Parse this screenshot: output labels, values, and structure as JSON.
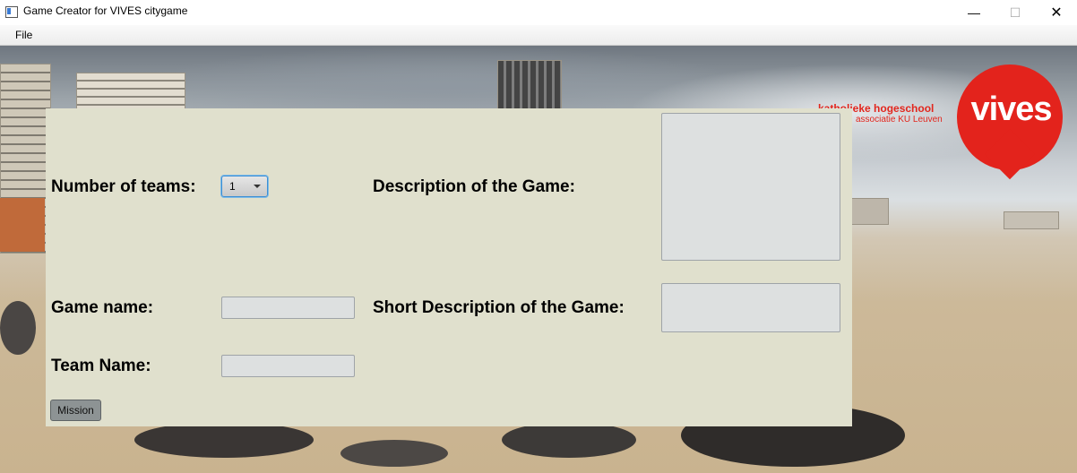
{
  "window": {
    "title": "Game Creator for VIVES citygame",
    "minimize_glyph": "—",
    "maximize_glyph": "☐",
    "close_glyph": "✕"
  },
  "menu": {
    "items": [
      "File"
    ]
  },
  "logo": {
    "line1": "katholieke hogeschool",
    "line2": "associatie KU Leuven",
    "word": "vives",
    "color": "#e3231c"
  },
  "form": {
    "teams_label": "Number of teams:",
    "teams_value": "1",
    "description_label": "Description of the Game:",
    "description_value": "",
    "game_name_label": "Game name:",
    "game_name_value": "",
    "short_description_label": "Short Description of the Game:",
    "short_description_value": "",
    "team_name_label": "Team Name:",
    "team_name_value": "",
    "mission_button": "Mission"
  },
  "colors": {
    "panel": "#e0e0cd",
    "field": "#dde0e0",
    "combo_focus": "#3c8fd4"
  },
  "icons": {
    "app": "app-window-icon",
    "combo_arrow": "chevron-down-icon"
  }
}
